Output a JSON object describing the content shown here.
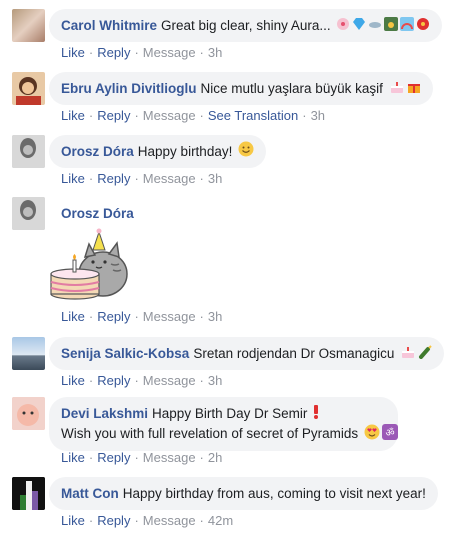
{
  "comments": [
    {
      "name": "Carol Whitmire",
      "text": "Great big clear, shiny Aura...",
      "actions": {
        "like": "Like",
        "reply": "Reply",
        "message": "Message",
        "time": "3h"
      }
    },
    {
      "name": "Ebru Aylin Divitlioglu",
      "text": "Nice mutlu yaşlara büyük kaşif",
      "actions": {
        "like": "Like",
        "reply": "Reply",
        "message": "Message",
        "translation": "See Translation",
        "time": "3h"
      }
    },
    {
      "name": "Orosz Dóra",
      "text": "Happy birthday!",
      "actions": {
        "like": "Like",
        "reply": "Reply",
        "message": "Message",
        "time": "3h"
      }
    },
    {
      "name": "Orosz Dóra",
      "sticker": "pusheen-birthday-cake-sticker",
      "actions": {
        "like": "Like",
        "reply": "Reply",
        "message": "Message",
        "time": "3h"
      }
    },
    {
      "name": "Senija Salkic-Kobsa",
      "text": "Sretan rodjendan Dr Osmanagicu",
      "actions": {
        "like": "Like",
        "reply": "Reply",
        "message": "Message",
        "time": "3h"
      }
    },
    {
      "name": "Devi Lakshmi",
      "text": "Happy Birth Day Dr Semir",
      "text2": "Wish you with full revelation of secret of Pyramids",
      "actions": {
        "like": "Like",
        "reply": "Reply",
        "message": "Message",
        "time": "2h"
      }
    },
    {
      "name": "Matt Con",
      "text": "Happy birthday from aus, coming to visit next year!",
      "actions": {
        "like": "Like",
        "reply": "Reply",
        "message": "Message",
        "time": "42m"
      }
    }
  ],
  "colors": {
    "link": "#385898",
    "muted": "#90949c",
    "bubble": "#f2f3f5",
    "text": "#1c1e21"
  }
}
